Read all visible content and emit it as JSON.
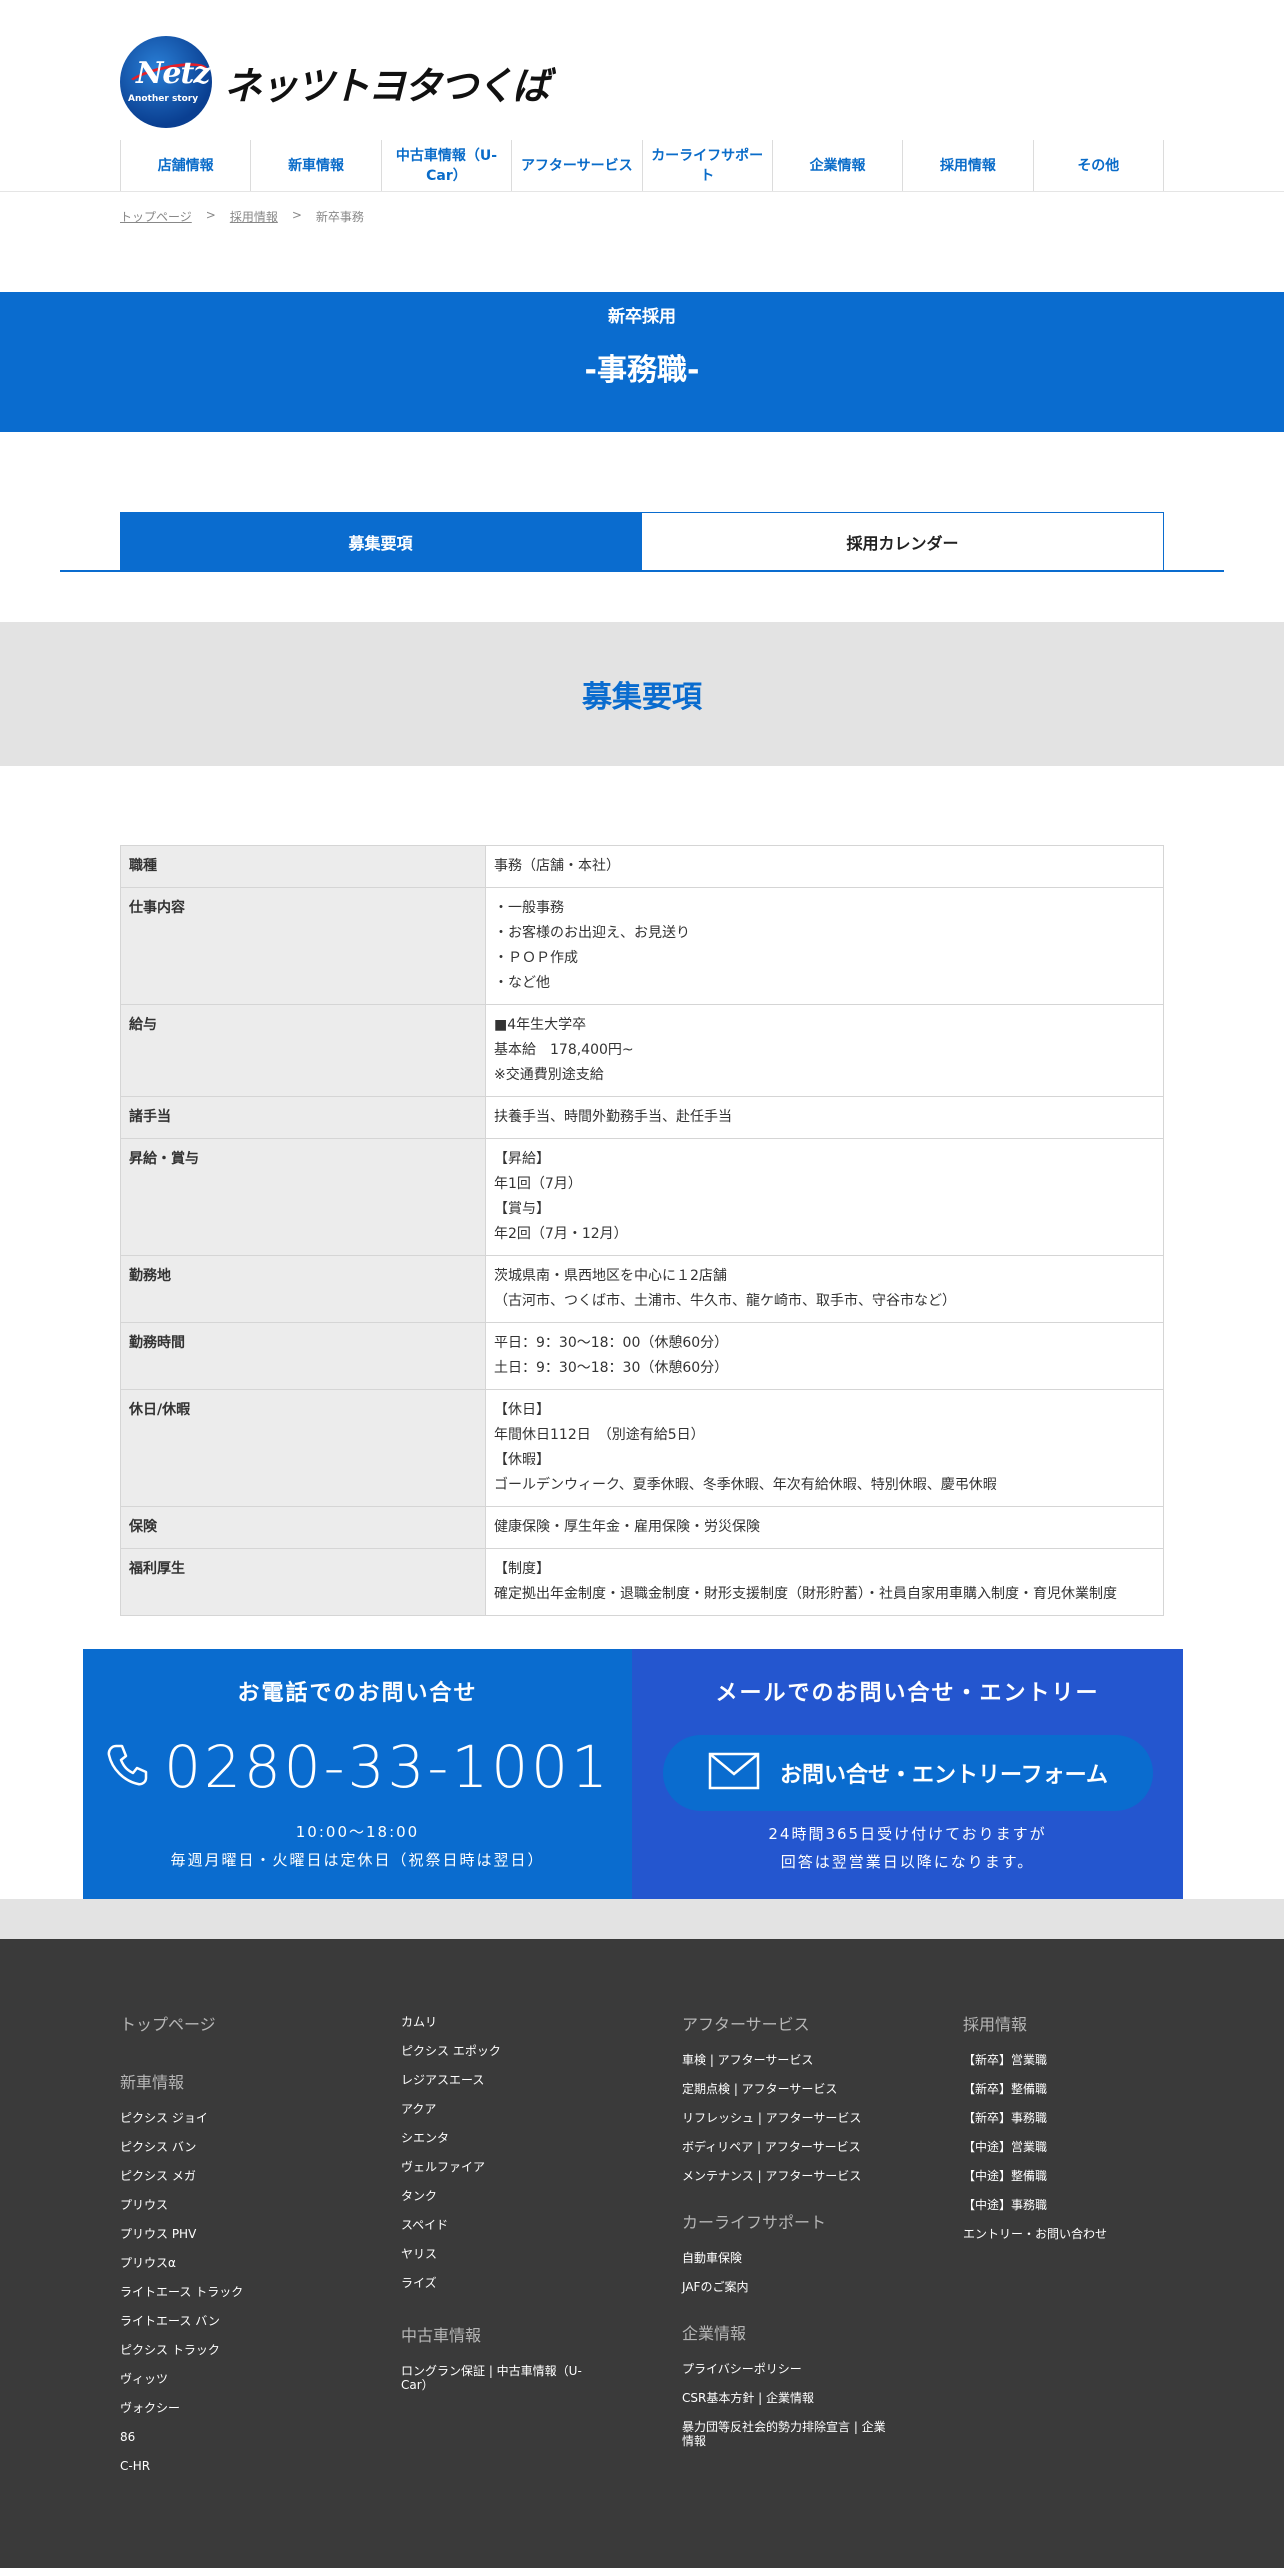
{
  "header": {
    "logo_text": "ネッツトヨタつくば",
    "logo_netz": "Netz",
    "logo_sub": "Another story",
    "nav": [
      "店舗情報",
      "新車情報",
      "中古車情報（U-Car）",
      "アフターサービス",
      "カーライフサポート",
      "企業情報",
      "採用情報",
      "その他"
    ]
  },
  "breadcrumb": {
    "items": [
      "トップページ",
      "採用情報",
      "新卒事務"
    ],
    "separator": ">"
  },
  "title_band": {
    "subtitle": "新卒採用",
    "title": "-事務職-"
  },
  "tabs": {
    "active": "募集要項",
    "inactive": "採用カレンダー"
  },
  "section": {
    "title": "募集要項"
  },
  "requirements": [
    {
      "label": "職種",
      "lines": [
        "事務（店舗・本社）"
      ]
    },
    {
      "label": "仕事内容",
      "lines": [
        "・一般事務",
        "・お客様のお出迎え、お見送り",
        "・ＰＯＰ作成",
        "・など他"
      ]
    },
    {
      "label": "給与",
      "lines": [
        "■4年生大学卒",
        "基本給　178,400円~",
        "※交通費別途支給"
      ]
    },
    {
      "label": "諸手当",
      "lines": [
        "扶養手当、時間外勤務手当、赴任手当"
      ]
    },
    {
      "label": "昇給・賞与",
      "lines": [
        "【昇給】",
        "年1回（7月）",
        "【賞与】",
        "年2回（7月・12月）"
      ]
    },
    {
      "label": "勤務地",
      "lines": [
        "茨城県南・県西地区を中心に１2店舗",
        "（古河市、つくば市、土浦市、牛久市、龍ケ崎市、取手市、守谷市など）"
      ]
    },
    {
      "label": "勤務時間",
      "lines": [
        "平日：9：30～18：00（休憩60分）",
        "土日：9：30～18：30（休憩60分）"
      ]
    },
    {
      "label": "休日/休暇",
      "lines": [
        "【休日】",
        "年間休日112日　（別途有給5日）",
        "【休暇】",
        "ゴールデンウィーク、夏季休暇、冬季休暇、年次有給休暇、特別休暇、慶弔休暇"
      ]
    },
    {
      "label": "保険",
      "lines": [
        "健康保険・厚生年金・雇用保険・労災保険"
      ]
    },
    {
      "label": "福利厚生",
      "lines": [
        "【制度】",
        "確定拠出年金制度・退職金制度・財形支援制度（財形貯蓄）・社員自家用車購入制度・育児休業制度"
      ]
    }
  ],
  "contact": {
    "phone_heading": "お電話でのお問い合せ",
    "phone_number": "0280-33-1001",
    "phone_hours": "10:00〜18:00",
    "phone_note": "毎週月曜日・火曜日は定休日（祝祭日時は翌日）",
    "mail_heading": "メールでのお問い合せ・エントリー",
    "mail_button": "お問い合せ・エントリーフォーム",
    "mail_note1": "24時間365日受け付けておりますが",
    "mail_note2": "回答は翌営業日以降になります。",
    "colors": {
      "phone_bg": "#0a6ccf",
      "mail_bg": "#2456cf"
    }
  },
  "footer": {
    "col1": {
      "top": "トップページ",
      "heading": "新車情報",
      "links": [
        "ピクシス ジョイ",
        "ピクシス バン",
        "ピクシス メガ",
        "プリウス",
        "プリウス PHV",
        "プリウスα",
        "ライトエース トラック",
        "ライトエース バン",
        "ピクシス トラック",
        "ヴィッツ",
        "ヴォクシー",
        "86",
        "C-HR"
      ]
    },
    "col2": {
      "links": [
        "カムリ",
        "ピクシス エポック",
        "レジアスエース",
        "アクア",
        "シエンタ",
        "ヴェルファイア",
        "タンク",
        "スペイド",
        "ヤリス",
        "ライズ"
      ],
      "heading": "中古車情報",
      "links2": [
        "ロングラン保証 | 中古車情報（U-Car）"
      ]
    },
    "col3": {
      "heading1": "アフターサービス",
      "links1": [
        "車検 | アフターサービス",
        "定期点検 | アフターサービス",
        "リフレッシュ | アフターサービス",
        "ボディリペア | アフターサービス",
        "メンテナンス | アフターサービス"
      ],
      "heading2": "カーライフサポート",
      "links2": [
        "自動車保険",
        "JAFのご案内"
      ],
      "heading3": "企業情報",
      "links3": [
        "プライバシーポリシー",
        "CSR基本方針 | 企業情報",
        "暴力団等反社会的勢力排除宣言 | 企業情報"
      ]
    },
    "col4": {
      "heading": "採用情報",
      "links": [
        "【新卒】営業職",
        "【新卒】整備職",
        "【新卒】事務職",
        "【中途】営業職",
        "【中途】整備職",
        "【中途】事務職",
        "エントリー・お問い合わせ"
      ]
    }
  }
}
